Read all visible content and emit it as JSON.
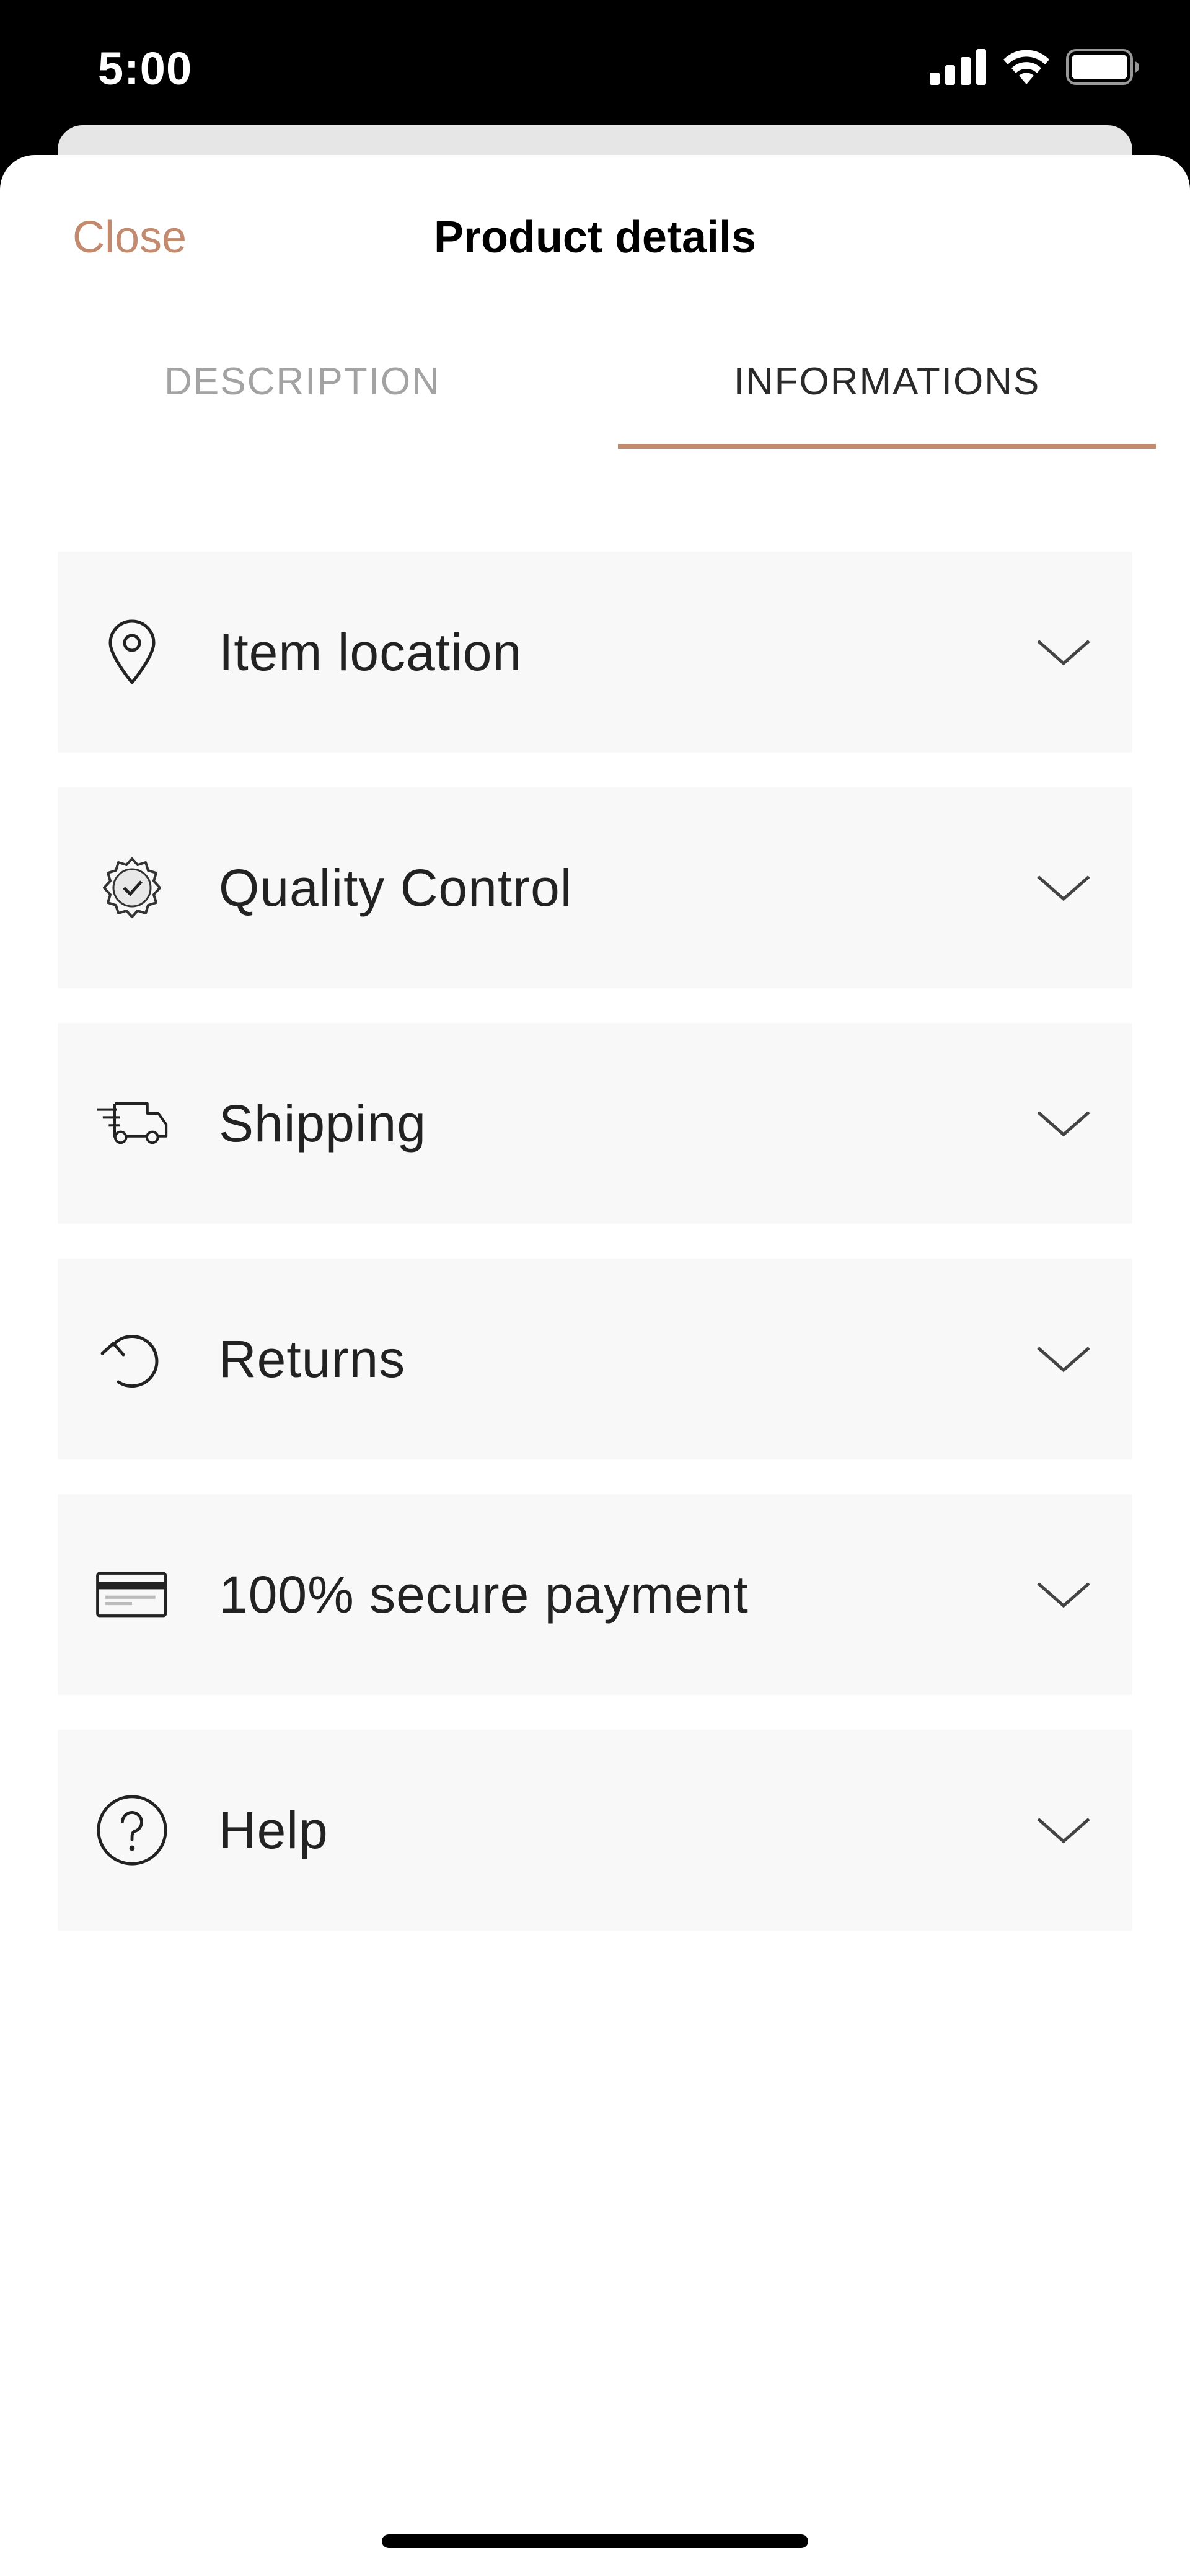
{
  "status_bar": {
    "time": "5:00",
    "icons": [
      "cellular-signal-icon",
      "wifi-icon",
      "battery-icon"
    ]
  },
  "sheet": {
    "close_label": "Close",
    "title": "Product details"
  },
  "tabs": [
    {
      "label": "DESCRIPTION",
      "active": false
    },
    {
      "label": "INFORMATIONS",
      "active": true
    }
  ],
  "items": [
    {
      "label": "Item location",
      "icon": "location-pin-icon"
    },
    {
      "label": "Quality Control",
      "icon": "certified-badge-icon"
    },
    {
      "label": "Shipping",
      "icon": "delivery-truck-icon"
    },
    {
      "label": "Returns",
      "icon": "return-arrow-icon"
    },
    {
      "label": "100% secure payment",
      "icon": "credit-card-icon"
    },
    {
      "label": "Help",
      "icon": "help-question-icon"
    }
  ],
  "colors": {
    "accent": "#c28a6e",
    "row_background": "#f8f8f8",
    "inactive_tab": "#a3a3a3"
  }
}
